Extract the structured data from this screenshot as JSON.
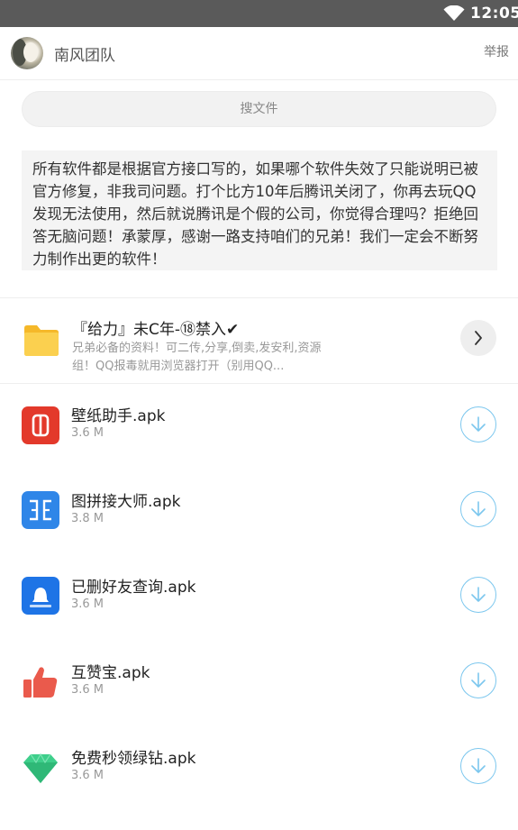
{
  "status_bar": {
    "time": "12:05",
    "icons": [
      "wifi-icon"
    ]
  },
  "header": {
    "team_name": "南风团队",
    "report_label": "举报"
  },
  "search": {
    "placeholder": "搜文件"
  },
  "notice": {
    "text": "所有软件都是根据官方接口写的，如果哪个软件失效了只能说明已被官方修复，非我司问题。打个比方10年后腾讯关闭了，你再去玩QQ发现无法使用，然后就说腾讯是个假的公司，你觉得合理吗？拒绝回答无脑问题！承蒙厚，感谢一路支持咱们的兄弟！我们一定会不断努力制作出更的软件！"
  },
  "folder": {
    "title": "『给力』未C年-⑱禁入✔",
    "description": "兄弟必备的资料！可二传,分享,倒卖,发安利,资源组！QQ报毒就用浏览器打开（别用QQ...",
    "icon": "folder-icon",
    "action_icon": "chevron-right-icon"
  },
  "files": [
    {
      "name": "壁纸助手.apk",
      "size": "3.6 M",
      "icon": "wallpaper-app-icon",
      "color": "#e3392b"
    },
    {
      "name": "图拼接大师.apk",
      "size": "3.8 M",
      "icon": "stitch-app-icon",
      "color": "#2f86e8"
    },
    {
      "name": "已删好友查询.apk",
      "size": "3.6 M",
      "icon": "friend-query-app-icon",
      "color": "#1e74e6"
    },
    {
      "name": "互赞宝.apk",
      "size": "3.6 M",
      "icon": "thumbs-up-icon",
      "color": "#ea5a4c"
    },
    {
      "name": "免费秒领绿钻.apk",
      "size": "3.6 M",
      "icon": "green-diamond-icon",
      "color": "#3ecf8b"
    }
  ],
  "colors": {
    "download_accent": "#7cc7ee",
    "folder_yellow": "#f7c43f",
    "status_bar": "#5a5a5a"
  }
}
